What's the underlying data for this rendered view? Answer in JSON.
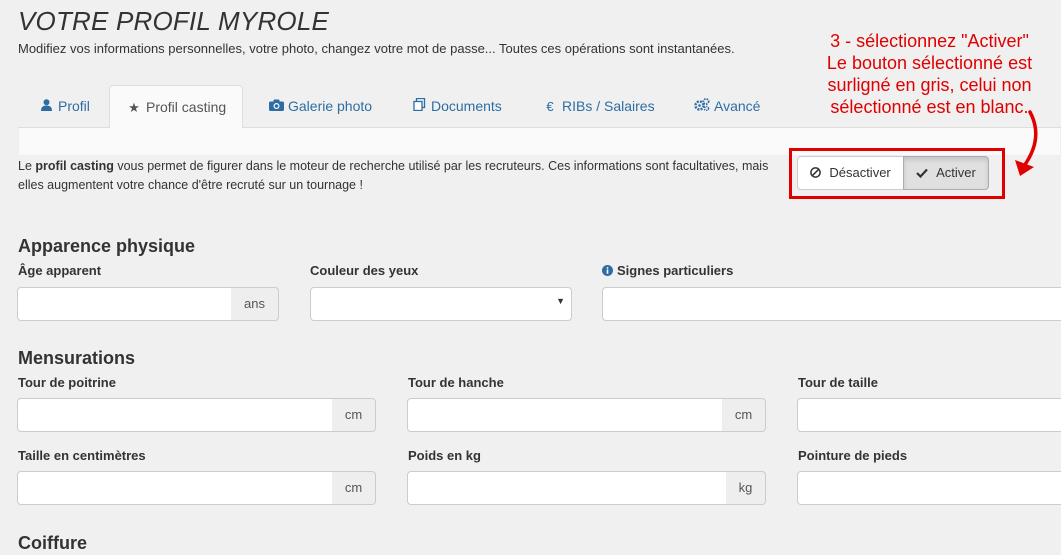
{
  "header": {
    "title": "VOTRE PROFIL MYROLE",
    "subtitle": "Modifiez vos informations personnelles, votre photo, changez votre mot de passe... Toutes ces opérations sont instantanées."
  },
  "tabs": [
    {
      "label": "Profil",
      "icon": "user-icon"
    },
    {
      "label": "Profil casting",
      "icon": "star-icon",
      "active": true
    },
    {
      "label": "Galerie photo",
      "icon": "camera-icon"
    },
    {
      "label": "Documents",
      "icon": "documents-icon"
    },
    {
      "label": "RIBs / Salaires",
      "icon": "euro-icon"
    },
    {
      "label": "Avancé",
      "icon": "gears-icon"
    }
  ],
  "intro": {
    "prefix": "Le ",
    "bold": "profil casting",
    "rest": " vous permet de figurer dans le moteur de recherche utilisé par les recruteurs. Ces informations sont facultatives, mais elles augmentent votre chance d'être recruté sur un tournage !"
  },
  "toggle": {
    "deactivate_label": "Désactiver",
    "activate_label": "Activer",
    "selected": "Activer"
  },
  "annotation": {
    "lines": [
      "3 - sélectionnez \"Activer\"",
      "Le bouton sélectionné est",
      "surligné en gris, celui non",
      "sélectionné est en blanc."
    ],
    "color": "#e00000"
  },
  "sections": {
    "apparence": {
      "title": "Apparence physique",
      "age_label": "Âge apparent",
      "age_value": "",
      "age_unit": "ans",
      "eyes_label": "Couleur des yeux",
      "eyes_value": "",
      "signs_label": "Signes particuliers",
      "signs_value": ""
    },
    "mensurations": {
      "title": "Mensurations",
      "chest_label": "Tour de poitrine",
      "chest_unit": "cm",
      "hip_label": "Tour de hanche",
      "hip_unit": "cm",
      "waist_label": "Tour de taille",
      "height_label": "Taille en centimètres",
      "height_unit": "cm",
      "weight_label": "Poids en kg",
      "weight_unit": "kg",
      "shoe_label": "Pointure de pieds"
    },
    "coiffure": {
      "title": "Coiffure"
    }
  },
  "colors": {
    "link": "#2e6da4",
    "annotation": "#e00000",
    "background": "#f0f0f0"
  }
}
